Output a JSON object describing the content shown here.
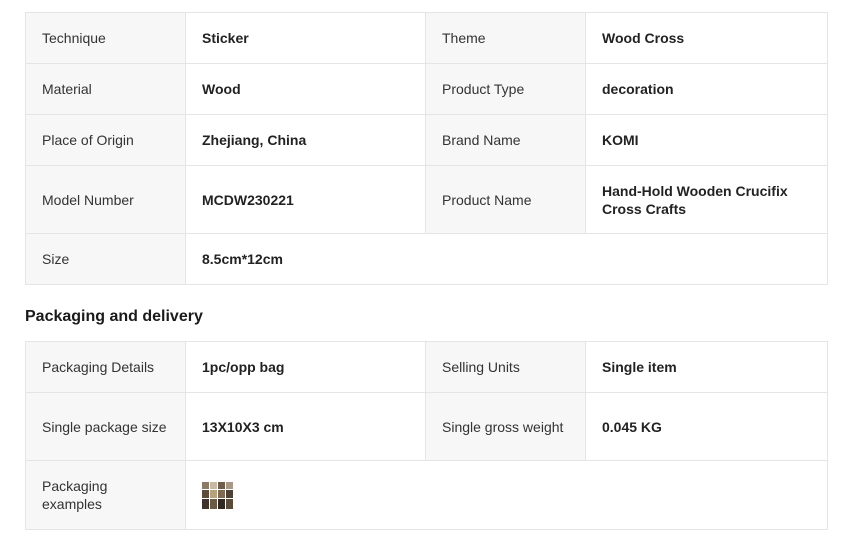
{
  "specs": {
    "rows": [
      {
        "k1": "Technique",
        "v1": "Sticker",
        "k2": "Theme",
        "v2": "Wood Cross"
      },
      {
        "k1": "Material",
        "v1": "Wood",
        "k2": "Product Type",
        "v2": "decoration"
      },
      {
        "k1": "Place of Origin",
        "v1": "Zhejiang, China",
        "k2": "Brand Name",
        "v2": "KOMI"
      },
      {
        "k1": "Model Number",
        "v1": "MCDW230221",
        "k2": "Product Name",
        "v2": "Hand-Hold Wooden Crucifix Cross Crafts"
      },
      {
        "k1": "Size",
        "v1": "8.5cm*12cm"
      }
    ]
  },
  "packaging": {
    "heading": "Packaging and delivery",
    "rows": [
      {
        "k1": "Packaging Details",
        "v1": "1pc/opp bag",
        "k2": "Selling Units",
        "v2": "Single item"
      },
      {
        "k1": "Single package size",
        "v1": "13X10X3 cm",
        "k2": "Single gross weight",
        "v2": "0.045 KG"
      },
      {
        "k1": "Packaging examples",
        "image": "packaging-example-thumbnail"
      }
    ]
  },
  "colors": {
    "key_cell_bg": "#f7f7f7",
    "border": "#e5e5e5",
    "text": "#222222"
  }
}
